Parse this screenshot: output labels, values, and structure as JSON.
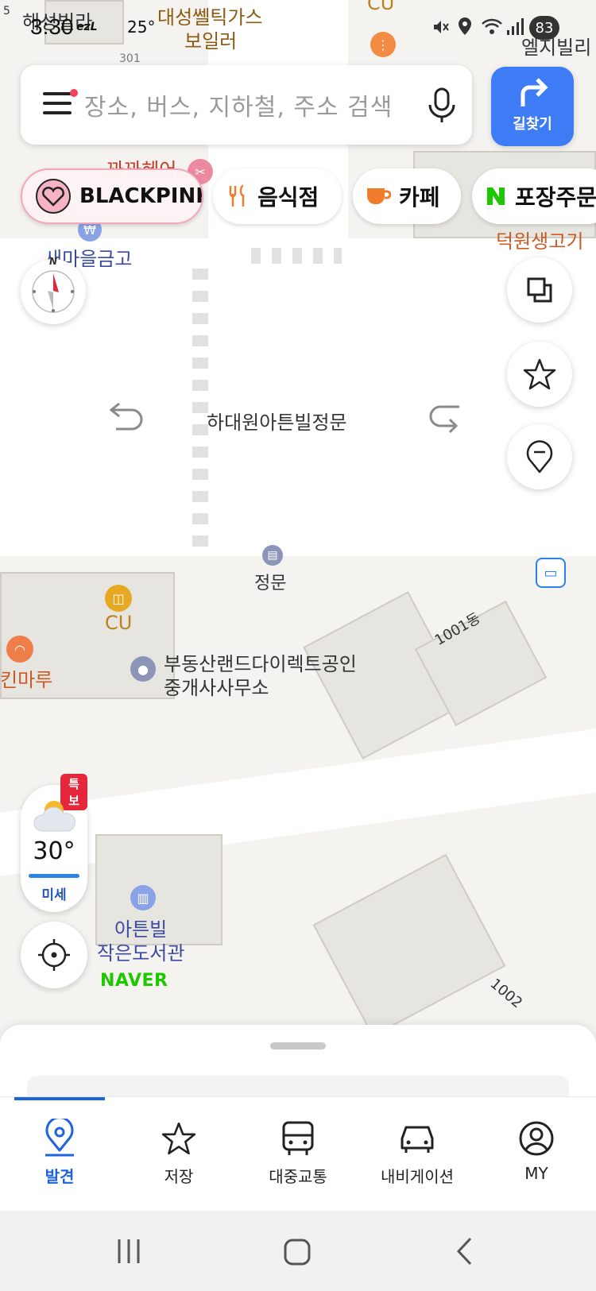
{
  "status_bar": {
    "time": "3:30",
    "carrier": "ezL",
    "weather_temp": "25°",
    "battery": "83",
    "icons": [
      "mute-icon",
      "location-icon",
      "wifi-icon",
      "signal-icon"
    ]
  },
  "search": {
    "placeholder": "장소, 버스, 지하철, 주소 검색",
    "route_label": "길찾기",
    "icons": [
      "menu-icon",
      "mic-icon",
      "route-arrow-icon"
    ]
  },
  "chips": [
    {
      "label": "BLACKPINK",
      "icon": "heart-icon"
    },
    {
      "label": "음식점",
      "icon": "fork-knife-icon"
    },
    {
      "label": "카페",
      "icon": "cup-icon"
    },
    {
      "label": "포장주문",
      "icon": "naver-n-icon"
    }
  ],
  "map": {
    "labels": {
      "top_left_a": "5",
      "top_left_b": "해성빌라",
      "gas_1": "대성쎌틱가스",
      "gas_2": "보일러",
      "num_301": "301",
      "cu_top": "CU",
      "right_villa": "엘지빌리",
      "pink_shop": "꽈꽈헤어",
      "finance": "새마을금고",
      "meat": "덕원생고기",
      "gate_full": "하대원아튼빌정문",
      "gate_small": "정문",
      "cu": "CU",
      "kinmaru": "킨마루",
      "realty_1": "부동산랜드다이렉트공인",
      "realty_2": "중개사사무소",
      "dong_1001": "1001동",
      "dong_1002": "1002",
      "library_1": "아튼빌",
      "library_2": "작은도서관",
      "naver": "NAVER"
    },
    "compass_label": "N"
  },
  "weather": {
    "badge": "특보",
    "temperature": "30°",
    "dust": "미세"
  },
  "bottom_nav": [
    {
      "label": "발견",
      "icon": "location-pin-icon",
      "active": true
    },
    {
      "label": "저장",
      "icon": "star-icon",
      "active": false
    },
    {
      "label": "대중교통",
      "icon": "bus-icon",
      "active": false
    },
    {
      "label": "내비게이션",
      "icon": "car-icon",
      "active": false
    },
    {
      "label": "MY",
      "icon": "person-icon",
      "active": false
    }
  ],
  "colors": {
    "accent": "#3d7cf5",
    "nav_active": "#1f63e0",
    "badge": "#e5263b",
    "naver_green": "#1ec800"
  }
}
